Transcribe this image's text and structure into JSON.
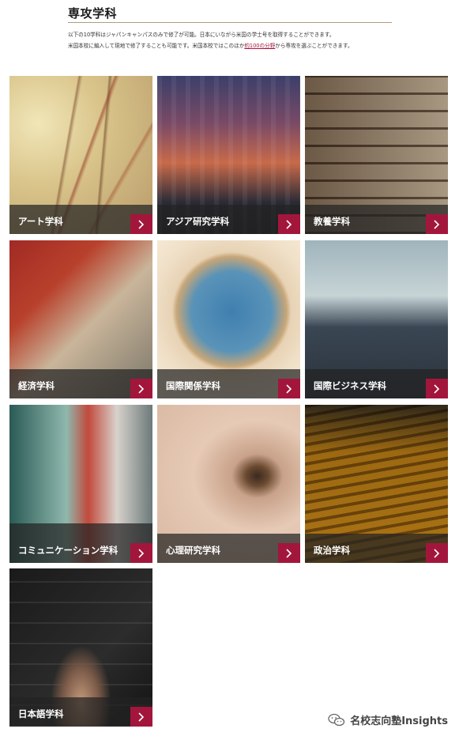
{
  "header": {
    "title": "専攻学科",
    "intro_line1": "以下の10学科はジャパンキャンパスのみで修了が可能。日本にいながら米国の学士号を取得することができます。",
    "intro_line2_pre": "米国本校に編入して現地で修了することも可能です。米国本校ではこのほか",
    "intro_line2_link": "約100の分野",
    "intro_line2_post": "から専攻を選ぶことができます。"
  },
  "majors": [
    {
      "label": "アート学科"
    },
    {
      "label": "アジア研究学科"
    },
    {
      "label": "教養学科"
    },
    {
      "label": "経済学科"
    },
    {
      "label": "国際関係学科"
    },
    {
      "label": "国際ビジネス学科"
    },
    {
      "label": "コミュニケーション学科"
    },
    {
      "label": "心理研究学科"
    },
    {
      "label": "政治学科"
    },
    {
      "label": "日本語学科"
    }
  ],
  "icons": {
    "tile_arrow": "chevron-right-icon",
    "watermark": "wechat-icon"
  },
  "colors": {
    "accent": "#a3163c",
    "bar": "#232323"
  },
  "watermark": {
    "text": "名校志向塾Insights"
  }
}
